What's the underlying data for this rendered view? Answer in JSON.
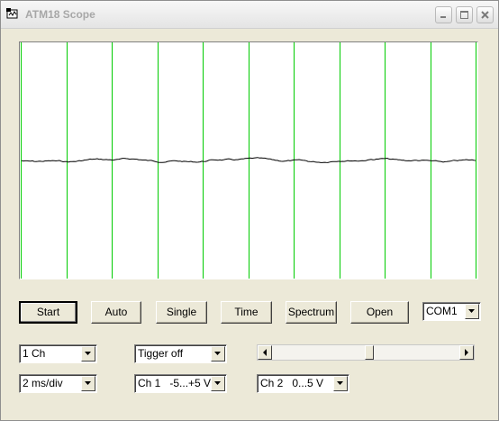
{
  "window": {
    "title": "ATM18 Scope"
  },
  "buttons": {
    "start": "Start",
    "auto": "Auto",
    "single": "Single",
    "time": "Time",
    "spectrum": "Spectrum",
    "open": "Open"
  },
  "port": {
    "selected": "COM1"
  },
  "channels": {
    "selected": "1 Ch"
  },
  "trigger": {
    "selected": "Tigger off"
  },
  "timebase": {
    "selected": "2 ms/div"
  },
  "ch1_range": {
    "selected": "Ch 1   -5...+5 V"
  },
  "ch2_range": {
    "selected": "Ch 2   0...5 V"
  },
  "trigger_level": {
    "value_fraction": 0.52
  },
  "scope": {
    "grid_color": "#00cc00",
    "trace_color": "#000000",
    "vertical_divisions": 10
  }
}
